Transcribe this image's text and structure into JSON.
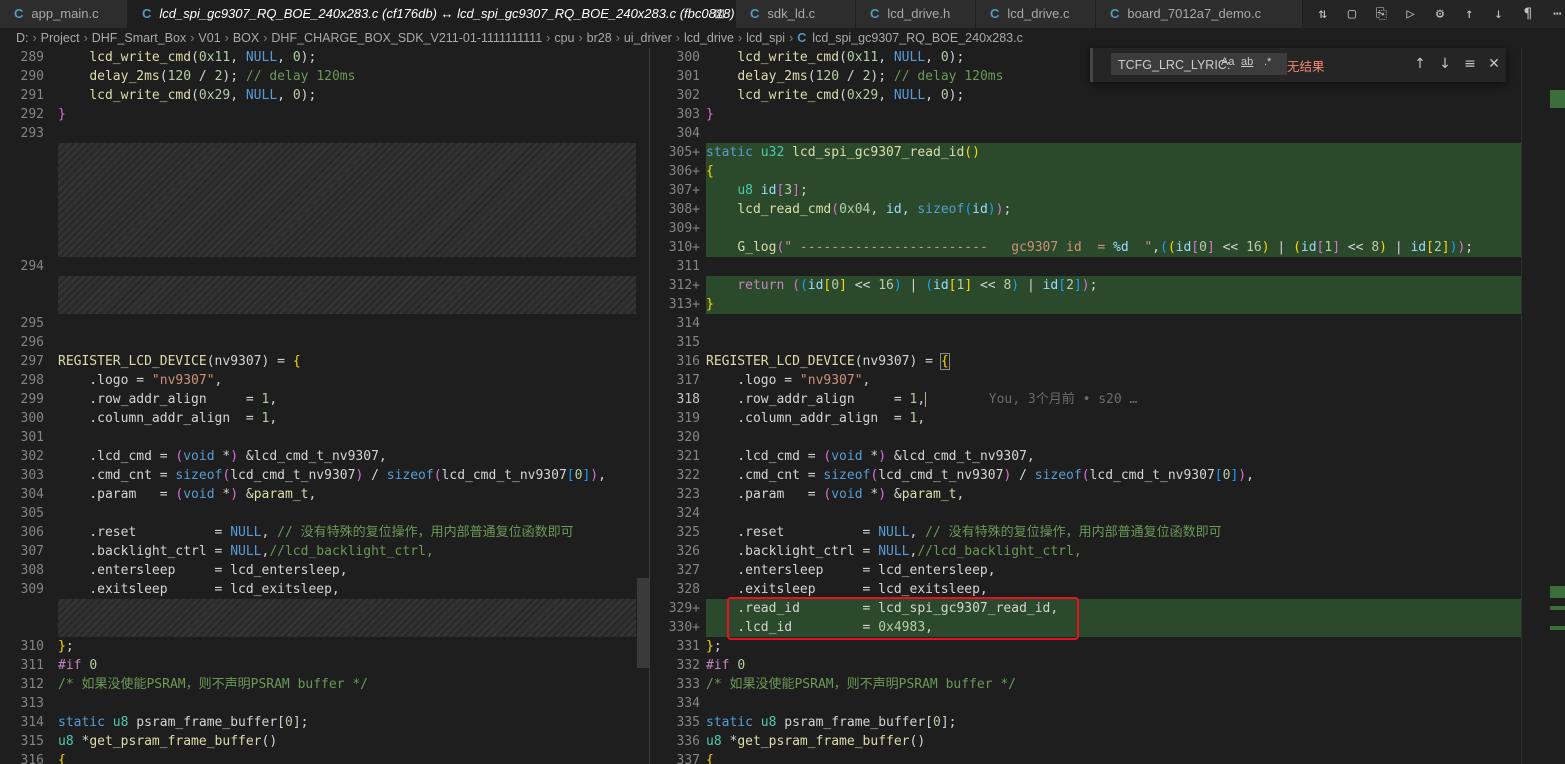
{
  "tabs": [
    {
      "icon": "C",
      "label": "app_main.c"
    },
    {
      "icon": "C",
      "label": "lcd_spi_gc9307_RQ_BOE_240x283.c (cf176db) ↔ lcd_spi_gc9307_RQ_BOE_240x283.c (fbc0818)",
      "active": true
    },
    {
      "icon": "C",
      "label": "sdk_ld.c"
    },
    {
      "icon": "C",
      "label": "lcd_drive.h"
    },
    {
      "icon": "C",
      "label": "lcd_drive.c"
    },
    {
      "icon": "C",
      "label": "board_7012a7_demo.c"
    }
  ],
  "tab_close_glyph": "⊠",
  "breadcrumb": [
    "D:",
    "Project",
    "DHF_Smart_Box",
    "V01",
    "BOX",
    "DHF_CHARGE_BOX_SDK_V211-01-1111111111",
    "cpu",
    "br28",
    "ui_driver",
    "lcd_drive",
    "lcd_spi",
    "lcd_spi_gc9307_RQ_BOE_240x283.c"
  ],
  "find": {
    "query": "TCFG_LRC_LYRIC:",
    "opt_case": "Aa",
    "opt_word": "ab",
    "opt_regex": ".*",
    "result": "无结果"
  },
  "blame_hint": "You, 3个月前 • s20 …",
  "left_lines": [
    "289",
    "290",
    "291",
    "292",
    "293",
    "294",
    "295",
    "296",
    "297",
    "298",
    "299",
    "300",
    "301",
    "302",
    "303",
    "304",
    "305",
    "306",
    "307",
    "308",
    "309",
    "310",
    "311",
    "312",
    "313",
    "314",
    "315",
    "316"
  ],
  "right_lines": [
    "300",
    "301",
    "302",
    "303",
    "304",
    "305+",
    "306+",
    "307+",
    "308+",
    "309+",
    "310+",
    "311",
    "312+",
    "313+",
    "314",
    "315",
    "316",
    "317",
    "318",
    "319",
    "320",
    "321",
    "322",
    "323",
    "324",
    "325",
    "326",
    "327",
    "328",
    "329+",
    "330+",
    "331",
    "332",
    "333",
    "334",
    "335",
    "336",
    "337"
  ]
}
